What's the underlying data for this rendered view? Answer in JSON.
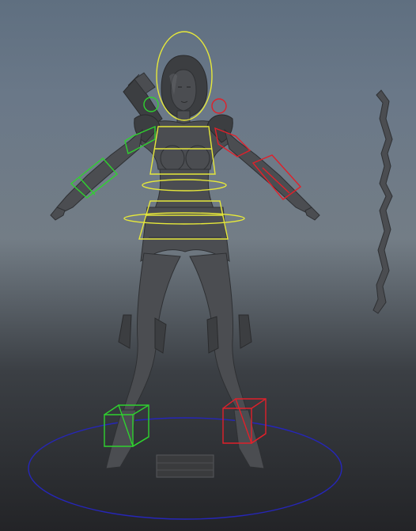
{
  "scene": {
    "colors": {
      "center_controls": "#e6e83a",
      "left_controls": "#2fd22f",
      "right_controls": "#e0202a",
      "ground_circle": "#2626b8",
      "model_shade": "#4b4d51"
    },
    "icons": [
      "character-mesh",
      "bow-prop",
      "quiver-prop",
      "head-control",
      "chest-control",
      "waist-control",
      "hip-control",
      "left-arm-control",
      "right-arm-control",
      "left-foot-control",
      "right-foot-control",
      "ground-circle-control"
    ]
  }
}
